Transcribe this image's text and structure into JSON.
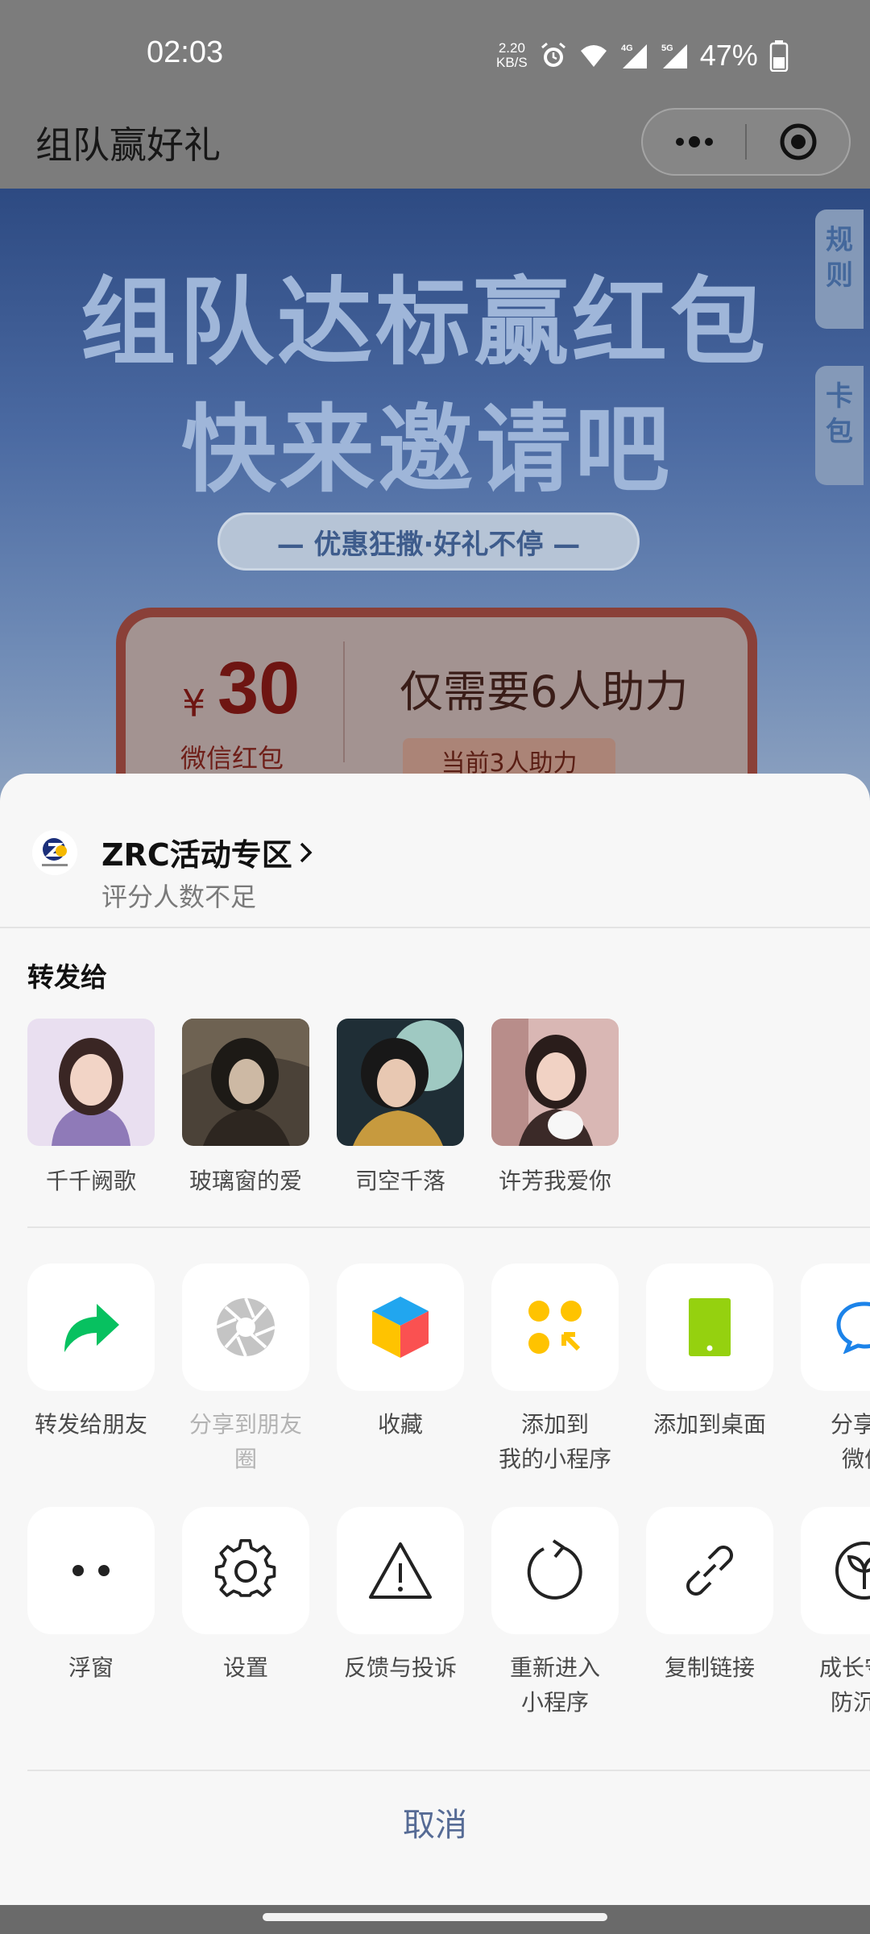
{
  "status_bar": {
    "time": "02:03",
    "net_speed_value": "2.20",
    "net_speed_unit": "KB/S",
    "battery": "47%",
    "icons": [
      "alarm-icon",
      "wifi-icon",
      "signal-4g-icon",
      "signal-5g-icon",
      "battery-icon"
    ]
  },
  "header": {
    "title": "组队赢好礼",
    "more_icon": "more-dots-icon",
    "close_icon": "target-close-icon"
  },
  "banner": {
    "headline_1": "组队达标赢红包",
    "headline_2": "快来邀请吧",
    "tagline": "— 优惠狂撒·好礼不停 —",
    "side_tab_rules": "规则",
    "side_tab_wallet": "卡包",
    "card": {
      "currency": "¥",
      "amount": "30",
      "amount_label": "微信红包",
      "need_text": "仅需要6人助力",
      "current_text": "当前3人助力"
    }
  },
  "sheet": {
    "mini_program": {
      "name": "ZRC活动专区",
      "subtitle": "评分人数不足"
    },
    "forward_title": "转发给",
    "contacts": [
      {
        "name": "千千阙歌"
      },
      {
        "name": "玻璃窗的爱"
      },
      {
        "name": "司空千落"
      },
      {
        "name": "许芳我爱你"
      }
    ],
    "actions_row_1": [
      {
        "label": "转发给朋友",
        "icon": "forward-arrow-icon",
        "disabled": false
      },
      {
        "label": "分享到朋友\n圈",
        "icon": "moments-shutter-icon",
        "disabled": true
      },
      {
        "label": "收藏",
        "icon": "favorite-cube-icon",
        "disabled": false
      },
      {
        "label": "添加到\n我的小程序",
        "icon": "add-mini-program-icon",
        "disabled": false
      },
      {
        "label": "添加到桌面",
        "icon": "add-to-desktop-icon",
        "disabled": false
      },
      {
        "label": "分享到\n微信",
        "icon": "chat-bubble-icon",
        "disabled": false
      }
    ],
    "actions_row_2": [
      {
        "label": "浮窗",
        "icon": "float-window-icon"
      },
      {
        "label": "设置",
        "icon": "gear-icon"
      },
      {
        "label": "反馈与投诉",
        "icon": "warning-icon"
      },
      {
        "label": "重新进入\n小程序",
        "icon": "reload-icon"
      },
      {
        "label": "复制链接",
        "icon": "link-icon"
      },
      {
        "label": "成长守护\n防沉迷",
        "icon": "sprout-icon"
      }
    ],
    "cancel_label": "取消"
  },
  "colors": {
    "sheet_bg": "#f7f7f7",
    "cancel_text": "#566b95",
    "forward_green": "#07c160",
    "favorite_blue": "#21a6ef",
    "mini_program_yellow": "#ffc300",
    "desktop_green": "#95d10f"
  }
}
